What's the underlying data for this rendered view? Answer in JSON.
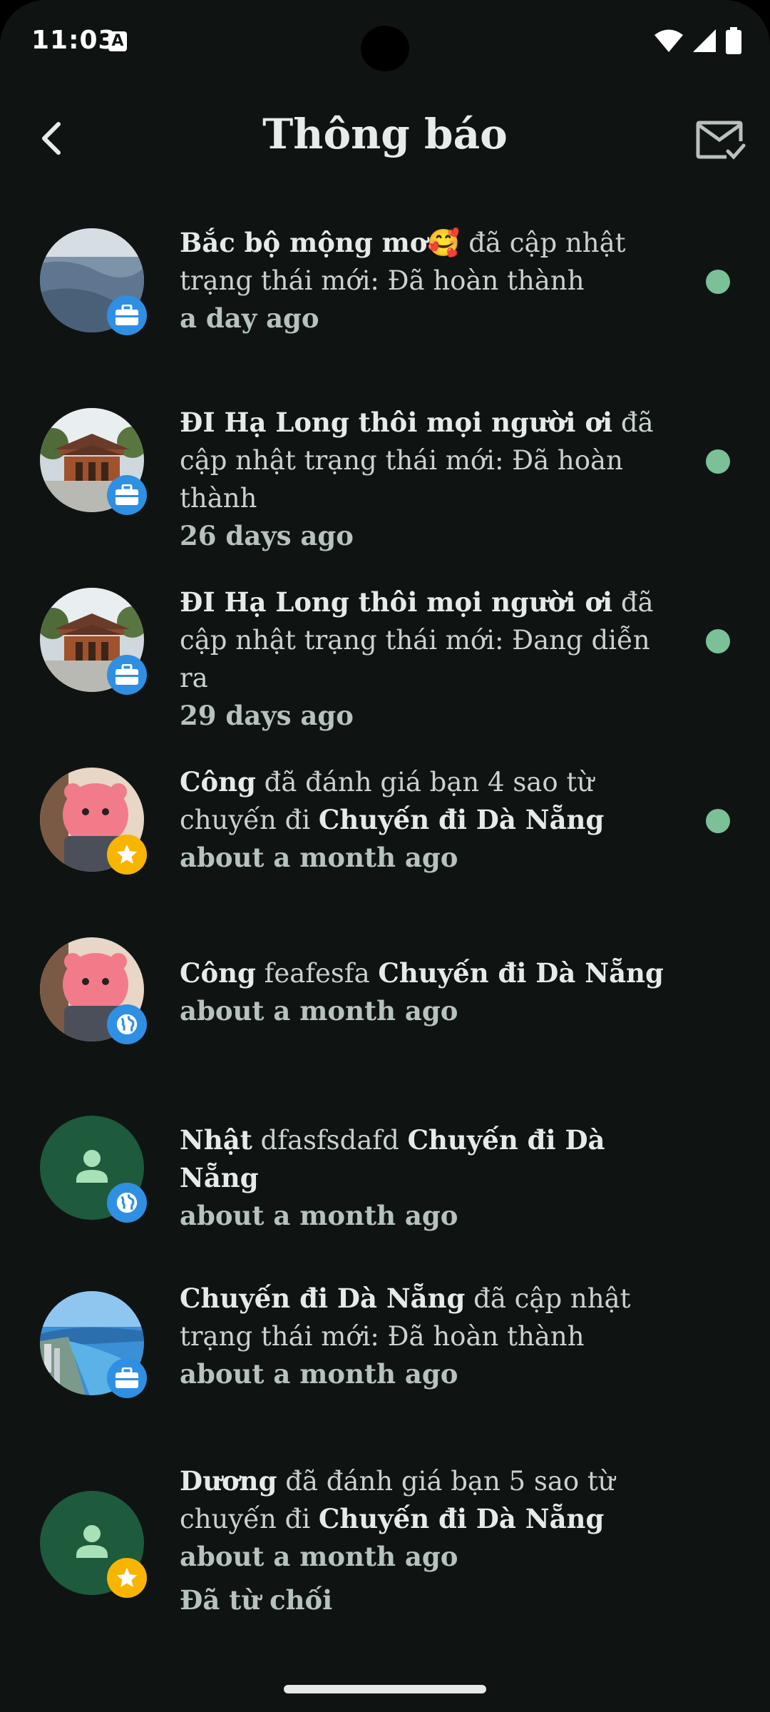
{
  "status_bar": {
    "time": "11:03",
    "a_icon": "A"
  },
  "header": {
    "title": "Thông báo"
  },
  "notifications": [
    {
      "bold": "Bắc bộ mộng mơ🥰",
      "rest": " đã cập nhật trạng thái mới: Đã hoàn thành",
      "time": "a day ago",
      "badge": "briefcase-icon",
      "unread": true
    },
    {
      "bold": "ĐI Hạ Long thôi mọi người ơi",
      "rest": " đã cập nhật trạng thái mới: Đã hoàn thành",
      "time": "26 days ago",
      "badge": "briefcase-icon",
      "unread": true
    },
    {
      "bold": "ĐI Hạ Long thôi mọi người ơi",
      "rest": " đã cập nhật trạng thái mới: Đang diễn ra",
      "time": "29 days ago",
      "badge": "briefcase-icon",
      "unread": true
    },
    {
      "bold": "Công",
      "rest": " đã đánh giá bạn 4 sao từ chuyến đi ",
      "bold2": "Chuyến đi Dà Nẵng",
      "time": "about a month ago",
      "badge": "star-icon",
      "unread": true
    },
    {
      "bold": "Công",
      "rest": " feafesfa ",
      "bold2": "Chuyến đi Dà Nẵng",
      "time": "about a month ago",
      "badge": "globe-icon",
      "unread": false
    },
    {
      "bold": "Nhật",
      "rest": " dfasfsdafd ",
      "bold2": "Chuyến đi Dà Nẵng",
      "time": "about a month ago",
      "badge": "globe-icon",
      "unread": false
    },
    {
      "bold": "Chuyến đi Dà Nẵng",
      "rest": " đã cập nhật trạng thái mới: Đã hoàn thành",
      "time": "about a month ago",
      "badge": "briefcase-icon",
      "unread": false
    },
    {
      "bold": "Dương",
      "rest": " đã đánh giá bạn 5 sao từ chuyến đi ",
      "bold2": "Chuyến đi Dà Nẵng",
      "time": "about a month ago",
      "status": "Đã từ chối",
      "badge": "star-icon",
      "unread": false
    }
  ],
  "colors": {
    "background": "#0f1413",
    "accent_dot": "#7bc096",
    "badge_blue": "#2f8fe3",
    "badge_yellow": "#f7b500",
    "placeholder_avatar": "#1e5a3c"
  }
}
